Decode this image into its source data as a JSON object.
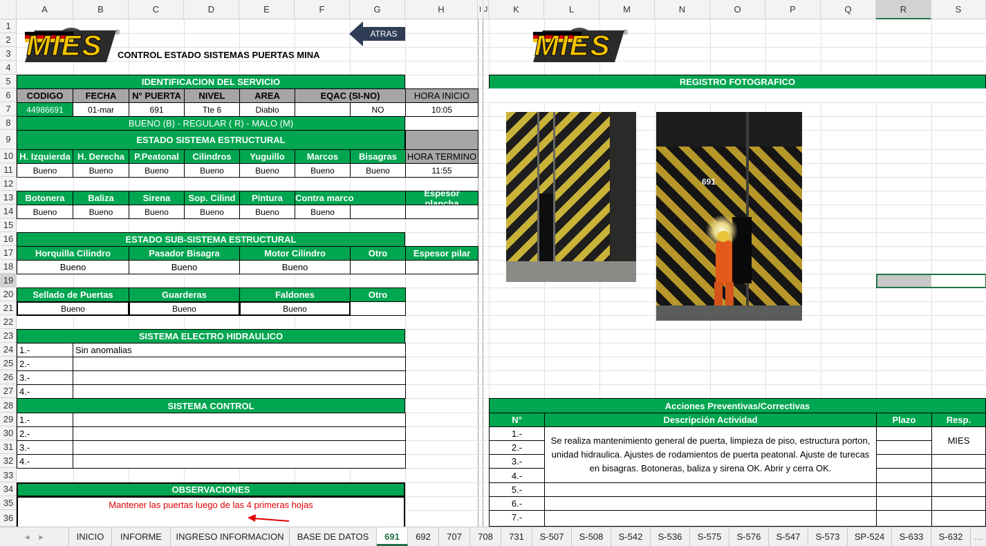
{
  "columns": [
    "A",
    "B",
    "C",
    "D",
    "E",
    "F",
    "G",
    "H",
    "I",
    "J",
    "K",
    "L",
    "M",
    "N",
    "O",
    "P",
    "Q",
    "R",
    "S"
  ],
  "rows": [
    "1",
    "2",
    "3",
    "4",
    "5",
    "6",
    "7",
    "8",
    "9",
    "10",
    "11",
    "12",
    "13",
    "14",
    "15",
    "16",
    "17",
    "18",
    "19",
    "20",
    "21",
    "22",
    "23",
    "24",
    "25",
    "26",
    "27",
    "28",
    "29",
    "30",
    "31",
    "32",
    "33",
    "34",
    "35",
    "36"
  ],
  "header": {
    "logo_text": "MIES",
    "logo_reg": "®",
    "title": "CONTROL ESTADO SISTEMAS PUERTAS MINA",
    "back_button": "ATRAS"
  },
  "ident": {
    "section_title": "IDENTIFICACION DEL SERVICIO",
    "headers": [
      "CODIGO",
      "FECHA",
      "N° PUERTA",
      "NIVEL",
      "AREA",
      "EQAC (SI-NO)",
      "HORA INICIO"
    ],
    "values": {
      "codigo": "44986691",
      "fecha": "01-mar",
      "puerta": "691",
      "nivel": "Tte 6",
      "area": "Diablo",
      "eqac": "NO",
      "hora_inicio": "10:05"
    },
    "legend": "BUENO (B) - REGULAR ( R) - MALO (M)"
  },
  "estructural": {
    "title": "ESTADO SISTEMA ESTRUCTURAL",
    "headers1": [
      "H. Izquierda",
      "H. Derecha",
      "P.Peatonal",
      "Cilindros",
      "Yuguillo",
      "Marcos",
      "Bisagras"
    ],
    "values1": [
      "Bueno",
      "Bueno",
      "Bueno",
      "Bueno",
      "Bueno",
      "Bueno",
      "Bueno"
    ],
    "hora_termino_label": "HORA TERMINO",
    "hora_termino": "11:55",
    "headers2": [
      "Botonera",
      "Baliza",
      "Sirena",
      "Sop. Cilind",
      "Pintura",
      "Contra marco"
    ],
    "values2": [
      "Bueno",
      "Bueno",
      "Bueno",
      "Bueno",
      "Bueno",
      "Bueno"
    ],
    "espesor_plancha": "Espesor plancha"
  },
  "subestructural": {
    "title": "ESTADO SUB-SISTEMA ESTRUCTURAL",
    "headers": [
      "Horquilla Cilindro",
      "Pasador Bisagra",
      "Motor Cilindro",
      "Otro"
    ],
    "values": [
      "Bueno",
      "Bueno",
      "Bueno"
    ],
    "espesor_pilar": "Espesor pilar",
    "headers2": [
      "Sellado de Puertas",
      "Guarderas",
      "Faldones",
      "Otro"
    ],
    "values2": [
      "Bueno",
      "Bueno",
      "Bueno"
    ]
  },
  "electro": {
    "title": "SISTEMA ELECTRO HIDRAULICO",
    "items": [
      "1.-",
      "2.-",
      "3.-",
      "4.-"
    ],
    "first_value": "Sin anomalias"
  },
  "control": {
    "title": "SISTEMA CONTROL",
    "items": [
      "1.-",
      "2.-",
      "3.-",
      "4.-"
    ]
  },
  "observaciones": {
    "title": "OBSERVACIONES",
    "note": "Mantener las puertas luego de las 4 primeras hojas"
  },
  "registro": {
    "title": "REGISTRO FOTOGRAFICO",
    "photo2_label": "691"
  },
  "acciones": {
    "title": "Acciones Preventivas/Correctivas",
    "headers": [
      "N°",
      "Descripción Actividad",
      "Plazo",
      "Resp."
    ],
    "items": [
      "1.-",
      "2.-",
      "3.-",
      "4.-",
      "5.-",
      "6.-",
      "7.-"
    ],
    "description": "Se realiza mantenimiento general de puerta, limpieza de piso, estructura porton, unidad hidraulica. Ajustes de rodamientos de puerta peatonal. Ajuste de turecas en bisagras. Botoneras, baliza y sirena OK. Abrir y cerra OK.",
    "resp": "MIES"
  },
  "tabs": [
    "INICIO",
    "INFORME",
    "INGRESO INFORMACION",
    "BASE DE DATOS",
    "691",
    "692",
    "707",
    "708",
    "731",
    "S-507",
    "S-508",
    "S-542",
    "S-536",
    "S-575",
    "S-576",
    "S-547",
    "S-573",
    "SP-524",
    "S-633",
    "S-632"
  ],
  "active_tab": "691",
  "colors": {
    "green": "#00a650",
    "gray": "#a6a6a6",
    "excel_green": "#217346"
  }
}
